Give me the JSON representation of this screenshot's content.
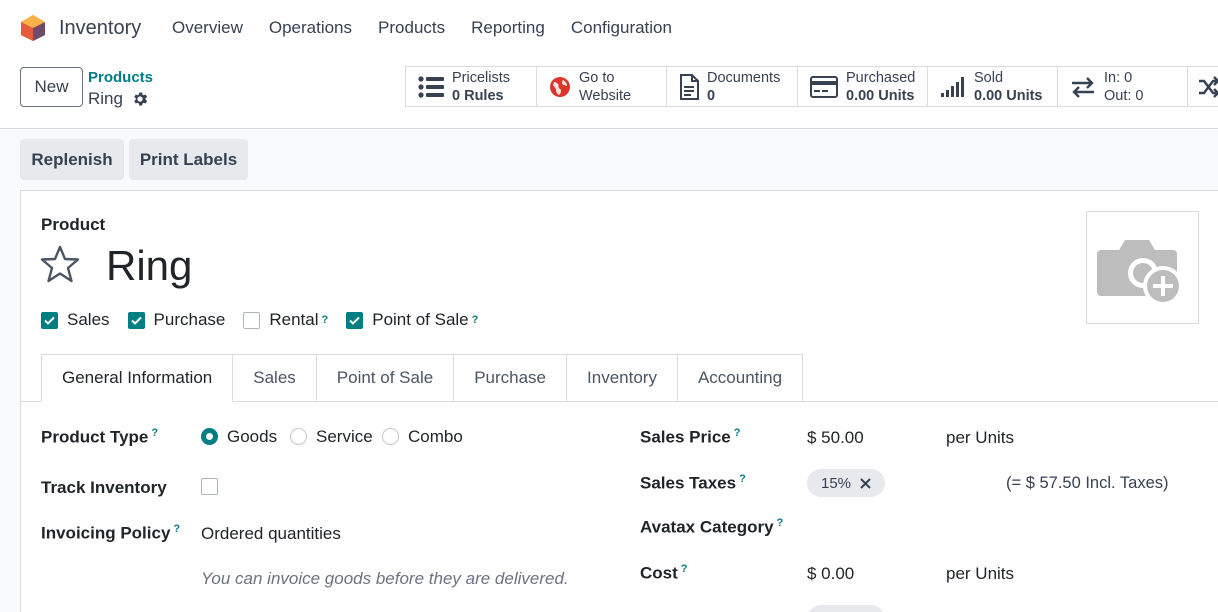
{
  "navbar": {
    "app_name": "Inventory",
    "menu": [
      "Overview",
      "Operations",
      "Products",
      "Reporting",
      "Configuration"
    ]
  },
  "control": {
    "new_label": "New",
    "breadcrumb_parent": "Products",
    "breadcrumb_current": "Ring",
    "stats": {
      "pricelists": {
        "label": "Pricelists",
        "value": "0 Rules"
      },
      "website": {
        "label": "Go to",
        "value": "Website"
      },
      "documents": {
        "label": "Documents",
        "value": "0"
      },
      "purchased": {
        "label": "Purchased",
        "value": "0.00 Units"
      },
      "sold": {
        "label": "Sold",
        "value": "0.00 Units"
      },
      "inout": {
        "label": "In: 0",
        "value": "Out: 0"
      }
    }
  },
  "actions": {
    "replenish": "Replenish",
    "print_labels": "Print Labels"
  },
  "form": {
    "header_label": "Product",
    "name": "Ring",
    "checks": {
      "sales": "Sales",
      "purchase": "Purchase",
      "rental": "Rental",
      "pos": "Point of Sale",
      "help": "?"
    },
    "tabs": [
      "General Information",
      "Sales",
      "Point of Sale",
      "Purchase",
      "Inventory",
      "Accounting"
    ],
    "product_type": {
      "label": "Product Type",
      "options": [
        "Goods",
        "Service",
        "Combo"
      ],
      "selected": "Goods"
    },
    "track_inventory": {
      "label": "Track Inventory"
    },
    "invoicing_policy": {
      "label": "Invoicing Policy",
      "value": "Ordered quantities",
      "hint": "You can invoice goods before they are delivered."
    },
    "sales_price": {
      "label": "Sales Price",
      "value": "$ 50.00",
      "unit": "per Units"
    },
    "sales_taxes": {
      "label": "Sales Taxes",
      "tag": "15%",
      "incl": "(= $ 57.50 Incl. Taxes)"
    },
    "avatax": {
      "label": "Avatax Category"
    },
    "cost": {
      "label": "Cost",
      "value": "$ 0.00",
      "unit": "per Units"
    }
  },
  "colors": {
    "accent": "#017e84",
    "brand": "#714b67"
  }
}
